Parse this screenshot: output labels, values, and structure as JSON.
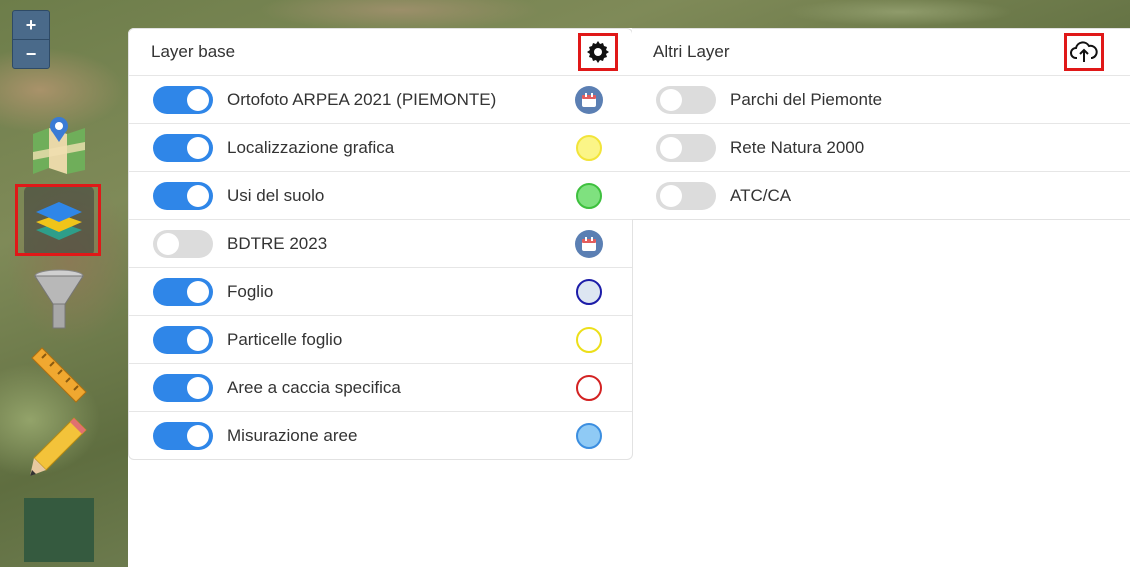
{
  "zoom": {
    "in_label": "+",
    "out_label": "−"
  },
  "sidebar": {
    "items": [
      {
        "name": "map-icon"
      },
      {
        "name": "layers-icon",
        "active": true
      },
      {
        "name": "filter-icon"
      },
      {
        "name": "ruler-icon"
      },
      {
        "name": "pencil-icon"
      }
    ]
  },
  "base_layers": {
    "title": "Layer base",
    "settings_icon": "gear-icon",
    "items": [
      {
        "label": "Ortofoto ARPEA 2021 (PIEMONTE)",
        "on": true,
        "icon": "calendar-icon"
      },
      {
        "label": "Localizzazione grafica",
        "on": true,
        "icon": "swatch",
        "fill": "#fbf587",
        "stroke": "#f2e43a"
      },
      {
        "label": "Usi del suolo",
        "on": true,
        "icon": "swatch",
        "fill": "#7fe17f",
        "stroke": "#3ec03e"
      },
      {
        "label": "BDTRE 2023",
        "on": false,
        "icon": "calendar-icon"
      },
      {
        "label": "Foglio",
        "on": true,
        "icon": "swatch",
        "fill": "#dde6f2",
        "stroke": "#1c1ca8"
      },
      {
        "label": "Particelle foglio",
        "on": true,
        "icon": "swatch",
        "fill": "#ffffff",
        "stroke": "#ecdf1a"
      },
      {
        "label": "Aree a caccia specifica",
        "on": true,
        "icon": "swatch",
        "fill": "#ffffff",
        "stroke": "#d32222"
      },
      {
        "label": "Misurazione aree",
        "on": true,
        "icon": "swatch",
        "fill": "#8fcaf5",
        "stroke": "#3b8ee0"
      }
    ]
  },
  "other_layers": {
    "title": "Altri Layer",
    "upload_icon": "cloud-upload-icon",
    "items": [
      {
        "label": "Parchi del Piemonte",
        "on": false
      },
      {
        "label": "Rete Natura 2000",
        "on": false
      },
      {
        "label": "ATC/CA",
        "on": false
      }
    ]
  },
  "colors": {
    "toggle_on": "#2f86e8",
    "toggle_off": "#dcdcdc",
    "highlight": "#e01818"
  }
}
